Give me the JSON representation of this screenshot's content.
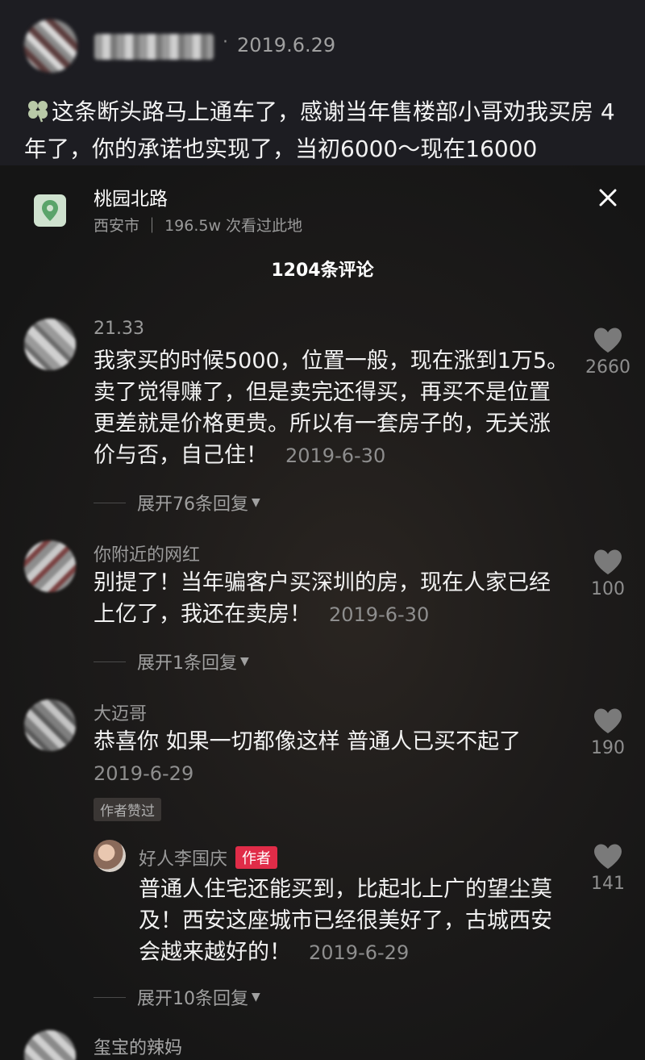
{
  "post": {
    "date": "2019.6.29",
    "dot": "·",
    "text": "这条断头路马上通车了，感谢当年售楼部小哥劝我买房 4年了，你的承诺也实现了，当初6000～现在16000"
  },
  "location": {
    "title": "桃园北路",
    "subtitle": "西安市 ｜ 196.5w 次看过此地",
    "icon": "location-pin-icon"
  },
  "comments_count": "1204条评论",
  "comments": [
    {
      "user": "21.33",
      "text": "我家买的时候5000，位置一般，现在涨到1万5。卖了觉得赚了，但是卖完还得买，再买不是位置更差就是价格更贵。所以有一套房子的，无关涨价与否，自己住！",
      "date": "2019-6-30",
      "likes": "2660",
      "expand": "展开76条回复"
    },
    {
      "user": "你附近的网红",
      "text": "别提了！当年骗客户买深圳的房，现在人家已经上亿了，我还在卖房！",
      "date": "2019-6-30",
      "likes": "100",
      "expand": "展开1条回复"
    },
    {
      "user": "大迈哥",
      "text": "恭喜你 如果一切都像这样 普通人已买不起了",
      "date": "2019-6-29",
      "likes": "190",
      "tag": "作者赞过"
    }
  ],
  "reply": {
    "user": "好人李国庆",
    "badge": "作者",
    "text": "普通人住宅还能买到，比起北上广的望尘莫及！西安这座城市已经很美好了，古城西安会越来越好的！",
    "date": "2019-6-29",
    "likes": "141",
    "expand": "展开10条回复"
  },
  "next_comment": {
    "user": "玺宝的辣妈"
  },
  "colors": {
    "author_badge": "#e02c48",
    "location_icon_bg": "#cfe2cf",
    "location_pin": "#5aa46a"
  }
}
